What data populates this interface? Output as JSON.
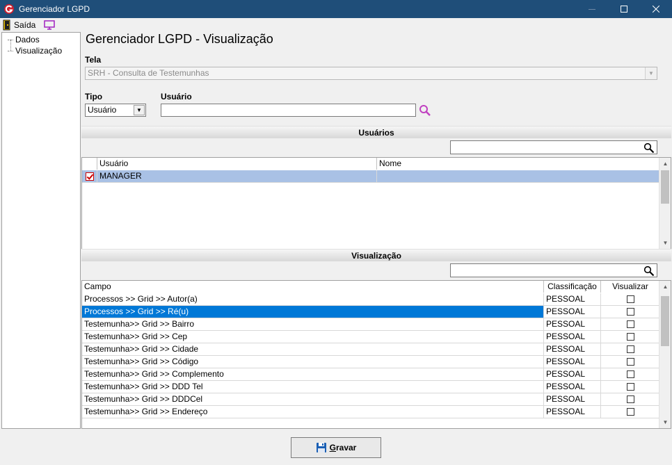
{
  "window": {
    "title": "Gerenciador LGPD"
  },
  "menu": {
    "exit_label": "Saída"
  },
  "tree": {
    "items": [
      "Dados",
      "Visualização"
    ]
  },
  "main": {
    "title": "Gerenciador LGPD - Visualização",
    "tela_label": "Tela",
    "tela_value": "SRH - Consulta de Testemunhas",
    "tipo_label": "Tipo",
    "tipo_value": "Usuário",
    "usuario_label": "Usuário",
    "usuario_value": ""
  },
  "users_section": {
    "title": "Usuários",
    "columns": [
      "Usuário",
      "Nome"
    ],
    "rows": [
      {
        "checked": true,
        "usuario": "MANAGER",
        "nome": ""
      }
    ]
  },
  "view_section": {
    "title": "Visualização",
    "columns": [
      "Campo",
      "Classificação",
      "Visualizar"
    ],
    "rows": [
      {
        "campo": "Processos >> Grid >> Autor(a)",
        "classificacao": "PESSOAL",
        "visualizar": false
      },
      {
        "campo": "Processos >> Grid >> Ré(u)",
        "classificacao": "PESSOAL",
        "visualizar": false
      },
      {
        "campo": "Testemunha>> Grid >> Bairro",
        "classificacao": "PESSOAL",
        "visualizar": false
      },
      {
        "campo": "Testemunha>> Grid >> Cep",
        "classificacao": "PESSOAL",
        "visualizar": false
      },
      {
        "campo": "Testemunha>> Grid >> Cidade",
        "classificacao": "PESSOAL",
        "visualizar": false
      },
      {
        "campo": "Testemunha>> Grid >> Código",
        "classificacao": "PESSOAL",
        "visualizar": false
      },
      {
        "campo": "Testemunha>> Grid >> Complemento",
        "classificacao": "PESSOAL",
        "visualizar": false
      },
      {
        "campo": "Testemunha>> Grid >> DDD Tel",
        "classificacao": "PESSOAL",
        "visualizar": false
      },
      {
        "campo": "Testemunha>> Grid >> DDDCel",
        "classificacao": "PESSOAL",
        "visualizar": false
      },
      {
        "campo": "Testemunha>> Grid >> Endereço",
        "classificacao": "PESSOAL",
        "visualizar": false
      }
    ]
  },
  "footer": {
    "save_label_first": "G",
    "save_label_rest": "ravar"
  },
  "colors": {
    "titlebar": "#1f4e79",
    "selection": "#0078d7",
    "selection_inactive": "#a9c1e5",
    "accent_icon": "#c040c0"
  }
}
